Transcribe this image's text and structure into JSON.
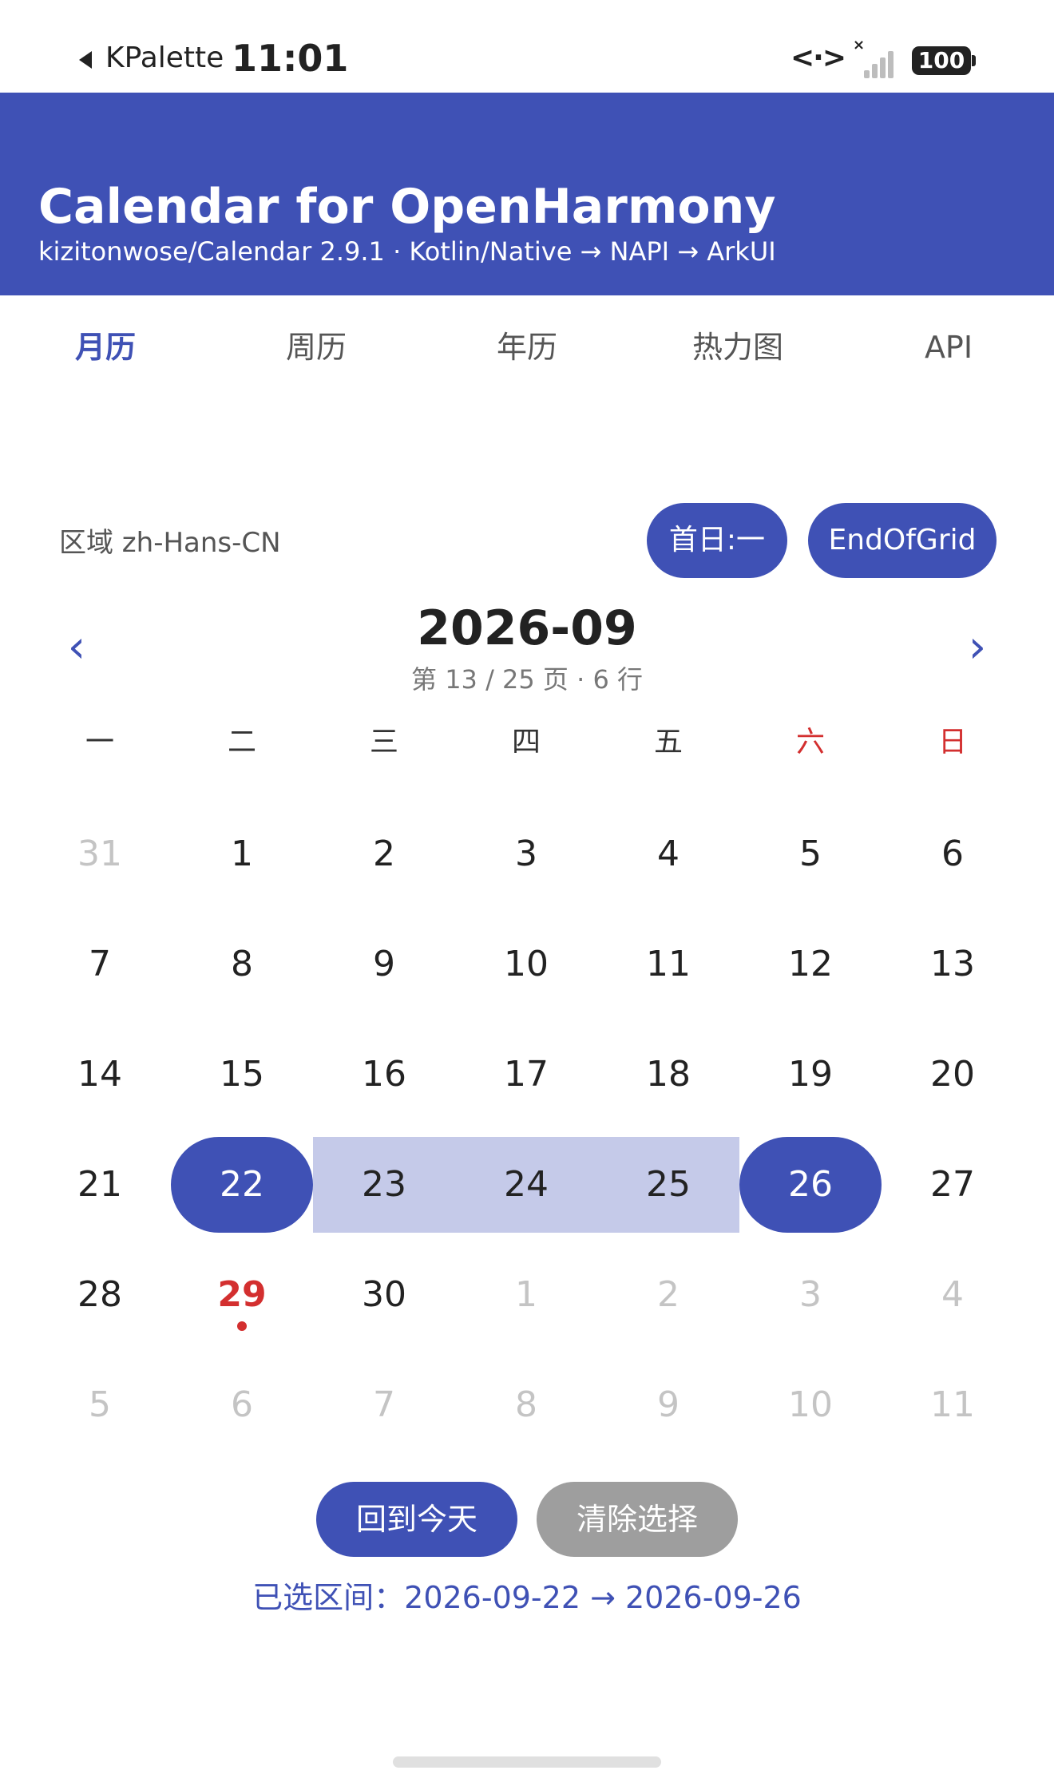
{
  "status_bar": {
    "back_app": "KPalette",
    "time": "11:01",
    "link_glyph": "<·>",
    "signal_off": "×",
    "battery": "100"
  },
  "header": {
    "title": "Calendar for OpenHarmony",
    "subtitle": "kizitonwose/Calendar 2.9.1 · Kotlin/Native → NAPI → ArkUI",
    "background_color": "#3f51b5"
  },
  "tabs": [
    {
      "label": "月历",
      "active": true
    },
    {
      "label": "周历",
      "active": false
    },
    {
      "label": "年历",
      "active": false
    },
    {
      "label": "热力图",
      "active": false
    },
    {
      "label": "API",
      "active": false
    }
  ],
  "controls": {
    "locale": "区域 zh-Hans-CN",
    "first_day_button": "首日:一",
    "out_date_button": "EndOfGrid"
  },
  "month_nav": {
    "prev_icon": "‹",
    "next_icon": "›",
    "month": "2026-09",
    "page_info": "第 13 / 25 页 · 6 行"
  },
  "weekdays": [
    "一",
    "二",
    "三",
    "四",
    "五",
    "六",
    "日"
  ],
  "weeks": [
    [
      "31",
      "1",
      "2",
      "3",
      "4",
      "5",
      "6"
    ],
    [
      "7",
      "8",
      "9",
      "10",
      "11",
      "12",
      "13"
    ],
    [
      "14",
      "15",
      "16",
      "17",
      "18",
      "19",
      "20"
    ],
    [
      "21",
      "22",
      "23",
      "24",
      "25",
      "26",
      "27"
    ],
    [
      "28",
      "29",
      "30",
      "1",
      "2",
      "3",
      "4"
    ],
    [
      "5",
      "6",
      "7",
      "8",
      "9",
      "10",
      "11"
    ]
  ],
  "actions": {
    "today_button": "回到今天",
    "clear_button": "清除选择",
    "selected_range": "已选区间：2026-09-22 → 2026-09-26"
  },
  "colors": {
    "primary": "#3f51b5",
    "range_fill": "#c5cae9",
    "weekend": "#d32f2f",
    "disabled_button": "#9e9e9e"
  }
}
